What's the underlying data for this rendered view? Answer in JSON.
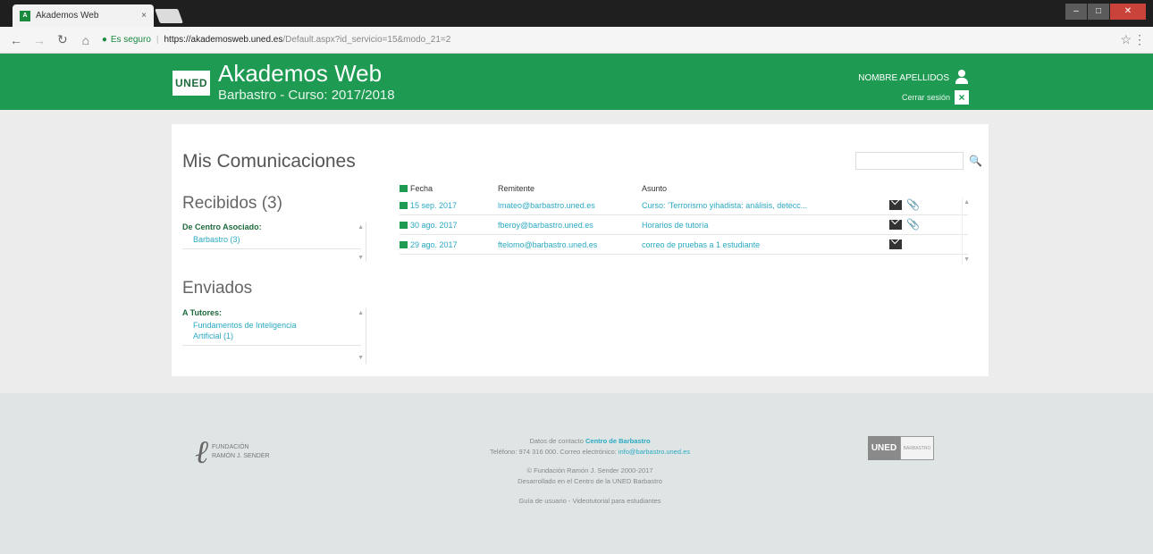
{
  "browser": {
    "tab_title": "Akademos Web",
    "tab_close": "×",
    "secure_label": "Es seguro",
    "url_host": "https://akademosweb.uned.es",
    "url_path": "/Default.aspx?id_servicio=15&modo_21=2"
  },
  "header": {
    "logo": "UNED",
    "title": "Akademos Web",
    "subtitle": "Barbastro - Curso: 2017/2018",
    "user_name": "NOMBRE APELLIDOS",
    "logout": "Cerrar sesión"
  },
  "page": {
    "title": "Mis Comunicaciones",
    "search_placeholder": ""
  },
  "received": {
    "title": "Recibidos (3)",
    "group": "De Centro Asociado:",
    "links": [
      "Barbastro (3)"
    ]
  },
  "sent": {
    "title": "Enviados",
    "group": "A Tutores:",
    "links": [
      "Fundamentos de Inteligencia",
      "Artificial (1)"
    ]
  },
  "table": {
    "headers": {
      "date": "Fecha",
      "sender": "Remitente",
      "subject": "Asunto"
    },
    "rows": [
      {
        "date": "15 sep. 2017",
        "sender": "lmateo@barbastro.uned.es",
        "subject": "Curso: 'Terrorismo yihadista: análisis, detecc...",
        "attachment": true
      },
      {
        "date": "30 ago. 2017",
        "sender": "fberoy@barbastro.uned.es",
        "subject": "Horarios de tutoría",
        "attachment": true
      },
      {
        "date": "29 ago. 2017",
        "sender": "ftelomo@barbastro.uned.es",
        "subject": "correo de pruebas a 1 estudiante",
        "attachment": false
      }
    ]
  },
  "footer": {
    "fundacion_line1": "FUNDACIÓN",
    "fundacion_line2": "RAMÓN J. SENDER",
    "contact_prefix": "Datos de contacto",
    "contact_center": "Centro de Barbastro",
    "phone_text": "Teléfono: 974 316 000. Correo electrónico:",
    "email": "info@barbastro.uned.es",
    "copyright": "© Fundación Ramón J. Sender 2000-2017",
    "developed": "Desarrollado en el Centro de la UNED Barbastro",
    "guides": "Guía de usuario - Videotutorial para estudiantes",
    "uned_logo": "UNED",
    "uned_sub": "BARBASTRO"
  }
}
